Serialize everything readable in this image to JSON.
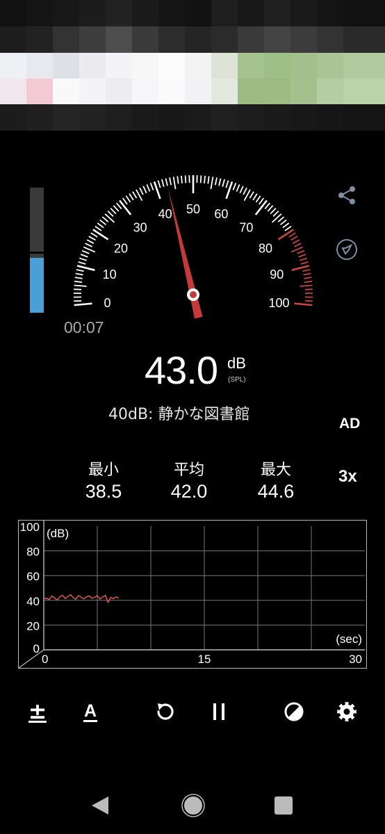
{
  "gauge": {
    "major_labels": [
      "0",
      "10",
      "20",
      "30",
      "40",
      "50",
      "60",
      "70",
      "80",
      "90",
      "100"
    ],
    "needle_db": 43.0,
    "red_zone_start_db": 80,
    "colors": {
      "needle": "#c43a3a",
      "red_zone": "#c94444",
      "ticks": "#ffffff"
    }
  },
  "level_meter": {
    "fill_fraction": 0.44,
    "peak_fraction": 0.47,
    "color": "#4a9fd4"
  },
  "elapsed_time": "00:07",
  "reading": {
    "value": "43.0",
    "unit": "dB",
    "unit_sub": "(SPL)"
  },
  "description": "40dB: 静かな図書館",
  "side_labels": {
    "weighting": "AD",
    "response": "3x"
  },
  "side_icons": [
    "share-icon",
    "compass-icon"
  ],
  "stats": [
    {
      "label": "最小",
      "value": "38.5"
    },
    {
      "label": "平均",
      "value": "42.0"
    },
    {
      "label": "最大",
      "value": "44.6"
    }
  ],
  "graph": {
    "y_unit_label": "(dB)",
    "x_unit_label": "(sec)",
    "y_ticks": [
      "0",
      "20",
      "40",
      "60",
      "80",
      "100"
    ],
    "x_ticks": [
      "0",
      "15",
      "30"
    ],
    "line_color": "#e05555"
  },
  "chart_data": {
    "type": "line",
    "xlabel": "(sec)",
    "ylabel": "(dB)",
    "xlim": [
      0,
      30
    ],
    "ylim": [
      0,
      100
    ],
    "grid": true,
    "x": [
      0.0,
      0.25,
      0.5,
      0.75,
      1.0,
      1.25,
      1.5,
      1.75,
      2.0,
      2.25,
      2.5,
      2.75,
      3.0,
      3.25,
      3.5,
      3.75,
      4.0,
      4.25,
      4.5,
      4.75,
      5.0,
      5.25,
      5.5,
      5.75,
      6.0,
      6.25,
      6.5,
      6.75,
      7.0
    ],
    "series": [
      {
        "values": [
          41.2,
          41.8,
          40.6,
          43.5,
          42.0,
          40.2,
          42.8,
          44.1,
          41.5,
          43.0,
          44.6,
          42.2,
          41.0,
          43.8,
          42.5,
          41.3,
          42.9,
          43.6,
          41.7,
          42.4,
          43.9,
          41.1,
          42.6,
          44.0,
          38.5,
          42.3,
          41.4,
          42.8,
          41.9
        ]
      }
    ]
  },
  "toolbar": {
    "buttons": [
      "calibrate-icon",
      "weighting-icon",
      "reset-icon",
      "pause-icon",
      "theme-icon",
      "settings-icon"
    ],
    "labels": {
      "calibrate": "±",
      "weighting": "A"
    }
  },
  "navbar": [
    "back-icon",
    "home-icon",
    "recents-icon"
  ]
}
